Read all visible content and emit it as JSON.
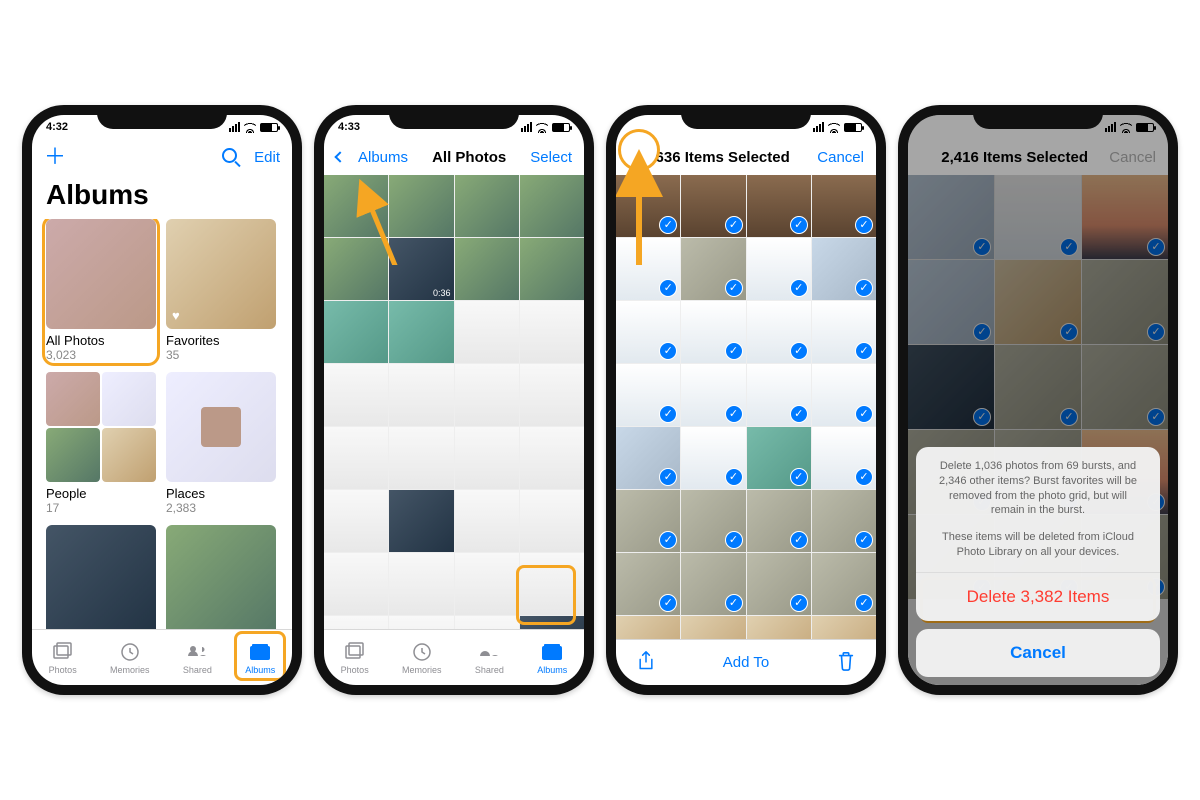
{
  "screen1": {
    "time": "4:32",
    "edit": "Edit",
    "heading": "Albums",
    "albums": [
      {
        "label": "All Photos",
        "count": "3,023"
      },
      {
        "label": "Favorites",
        "count": "35"
      },
      {
        "label": "People",
        "count": "17"
      },
      {
        "label": "Places",
        "count": "2,383"
      }
    ],
    "tabs": [
      "Photos",
      "Memories",
      "Shared",
      "Albums"
    ]
  },
  "screen2": {
    "time": "4:33",
    "back": "Albums",
    "title": "All Photos",
    "select": "Select",
    "duration": "0:36",
    "tabs": [
      "Photos",
      "Memories",
      "Shared",
      "Albums"
    ]
  },
  "screen3": {
    "title": "636 Items Selected",
    "cancel": "Cancel",
    "addto": "Add To"
  },
  "screen4": {
    "title": "2,416 Items Selected",
    "cancel": "Cancel",
    "sheet": {
      "msg1": "Delete 1,036 photos from 69 bursts, and 2,346 other items? Burst favorites will be removed from the photo grid, but will remain in the burst.",
      "msg2": "These items will be deleted from iCloud Photo Library on all your devices.",
      "delete": "Delete 3,382 Items",
      "cancel": "Cancel"
    }
  }
}
